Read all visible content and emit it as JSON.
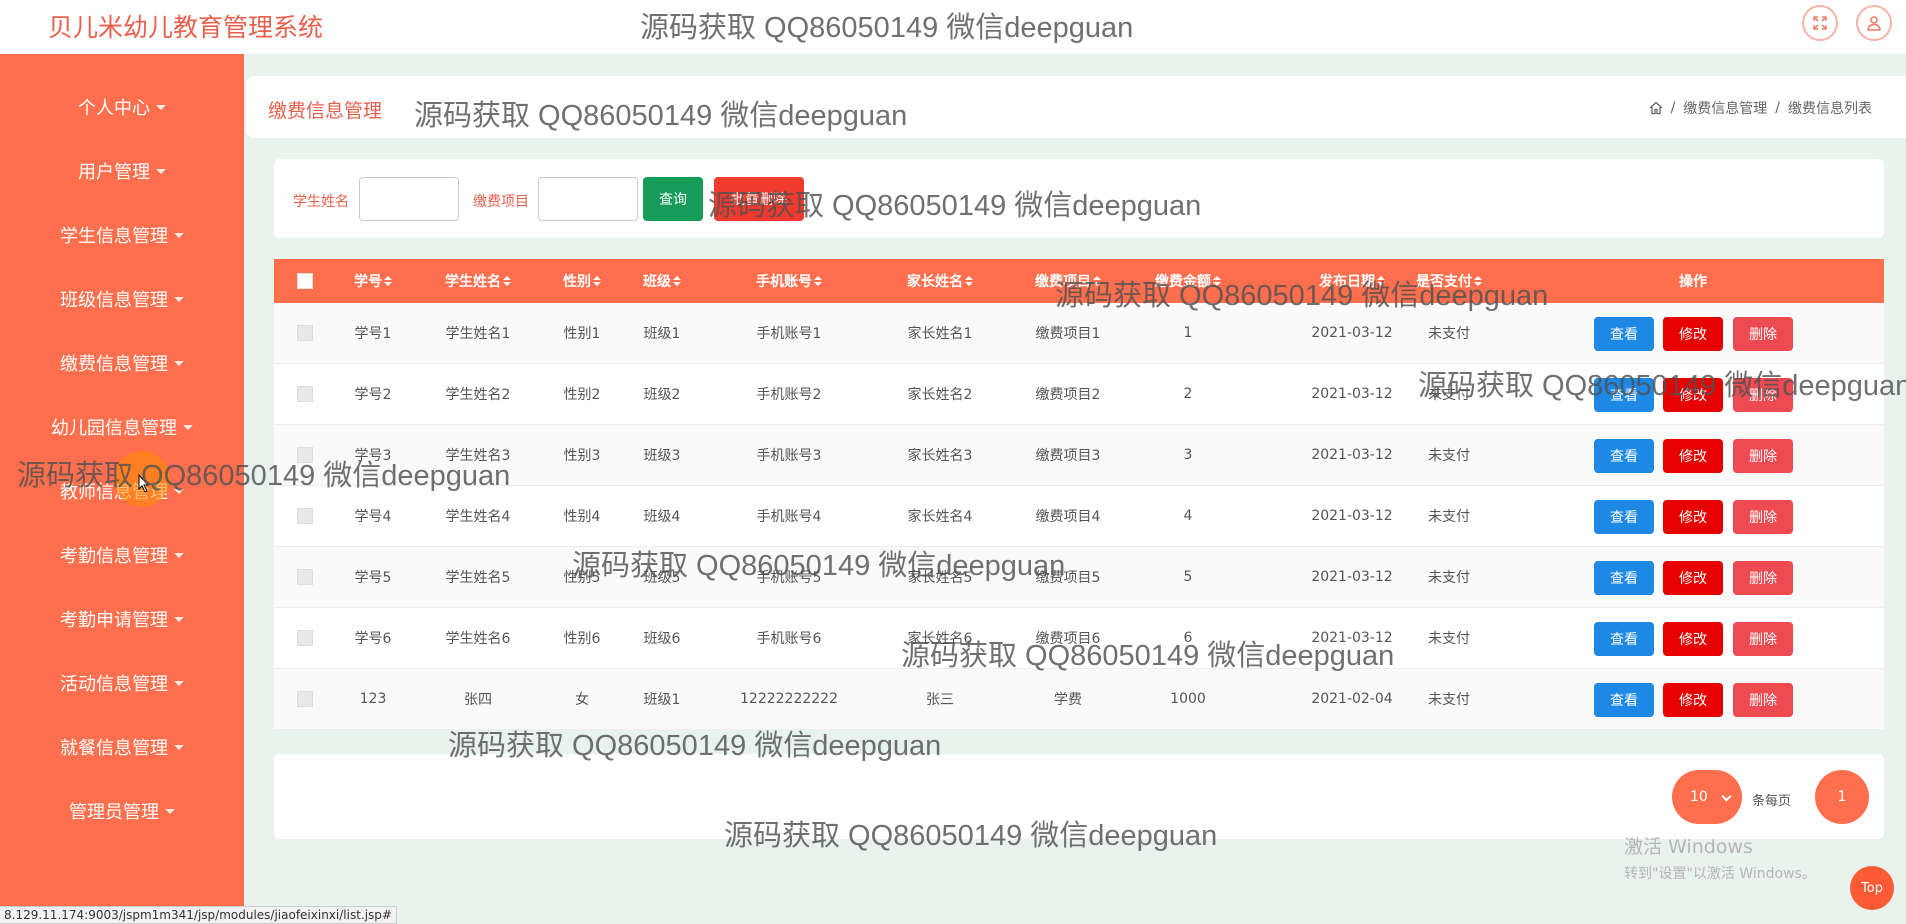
{
  "header": {
    "app_title": "贝儿米幼儿教育管理系统",
    "icons": [
      "fullscreen-icon",
      "user-icon"
    ]
  },
  "sidebar": {
    "items": [
      {
        "label": "个人中心"
      },
      {
        "label": "用户管理"
      },
      {
        "label": "学生信息管理"
      },
      {
        "label": "班级信息管理"
      },
      {
        "label": "缴费信息管理"
      },
      {
        "label": "幼儿园信息管理"
      },
      {
        "label": "教师信息管理"
      },
      {
        "label": "考勤信息管理"
      },
      {
        "label": "考勤申请管理"
      },
      {
        "label": "活动信息管理"
      },
      {
        "label": "就餐信息管理"
      },
      {
        "label": "管理员管理"
      }
    ]
  },
  "breadcrumb": {
    "page_title": "缴费信息管理",
    "path": [
      "缴费信息管理",
      "缴费信息列表"
    ],
    "separator": "/"
  },
  "search": {
    "student_name_label": "学生姓名",
    "student_name_value": "",
    "fee_item_label": "缴费项目",
    "fee_item_value": "",
    "query_button": "查询",
    "batch_delete_button": "批量删除"
  },
  "table": {
    "columns": [
      "学号",
      "学生姓名",
      "性别",
      "班级",
      "手机账号",
      "家长姓名",
      "缴费项目",
      "缴费金额",
      "发布日期",
      "是否支付",
      "操作"
    ],
    "rows": [
      [
        "学号1",
        "学生姓名1",
        "性别1",
        "班级1",
        "手机账号1",
        "家长姓名1",
        "缴费项目1",
        "1",
        "2021-03-12",
        "未支付"
      ],
      [
        "学号2",
        "学生姓名2",
        "性别2",
        "班级2",
        "手机账号2",
        "家长姓名2",
        "缴费项目2",
        "2",
        "2021-03-12",
        "未支付"
      ],
      [
        "学号3",
        "学生姓名3",
        "性别3",
        "班级3",
        "手机账号3",
        "家长姓名3",
        "缴费项目3",
        "3",
        "2021-03-12",
        "未支付"
      ],
      [
        "学号4",
        "学生姓名4",
        "性别4",
        "班级4",
        "手机账号4",
        "家长姓名4",
        "缴费项目4",
        "4",
        "2021-03-12",
        "未支付"
      ],
      [
        "学号5",
        "学生姓名5",
        "性别5",
        "班级5",
        "手机账号5",
        "家长姓名5",
        "缴费项目5",
        "5",
        "2021-03-12",
        "未支付"
      ],
      [
        "学号6",
        "学生姓名6",
        "性别6",
        "班级6",
        "手机账号6",
        "家长姓名6",
        "缴费项目6",
        "6",
        "2021-03-12",
        "未支付"
      ],
      [
        "123",
        "张四",
        "女",
        "班级1",
        "12222222222",
        "张三",
        "学费",
        "1000",
        "2021-02-04",
        "未支付"
      ]
    ],
    "actions": {
      "view": "查看",
      "edit": "修改",
      "delete": "删除"
    }
  },
  "pagination": {
    "page_size": "10",
    "per_page_label": "条每页",
    "current_page": "1"
  },
  "windows_activation": {
    "line1": "激活 Windows",
    "line2": "转到\"设置\"以激活 Windows。"
  },
  "top_button": "Top",
  "status_url": "8.129.11.174:9003/jspm1m341/jsp/modules/jiaofeixinxi/list.jsp#",
  "watermark_text": "源码获取 QQ86050149 微信deepguan",
  "colors": {
    "accent": "#ff6f4d",
    "title": "#e8604c",
    "query": "#179b59",
    "view": "#1e88e5",
    "edit": "#e60000",
    "delete": "#ee4a52"
  }
}
